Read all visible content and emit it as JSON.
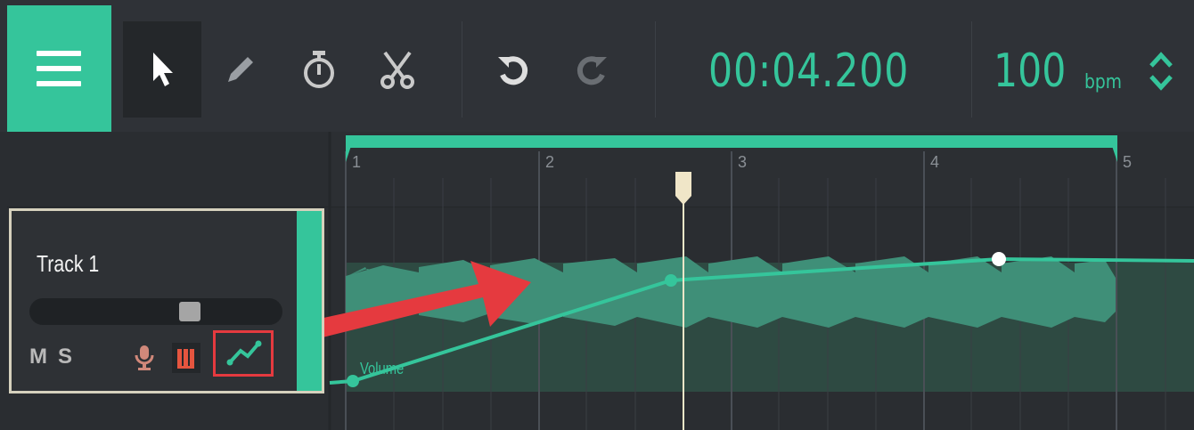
{
  "toolbar": {
    "menu_icon": "hamburger-menu-icon",
    "tools": [
      {
        "name": "select-tool",
        "icon": "cursor-arrow-icon",
        "active": true
      },
      {
        "name": "pencil-tool",
        "icon": "pencil-icon",
        "active": false
      },
      {
        "name": "metronome-tool",
        "icon": "stopwatch-icon",
        "active": false
      },
      {
        "name": "cut-tool",
        "icon": "scissors-icon",
        "active": false
      }
    ],
    "undo_icon": "undo-icon",
    "redo_icon": "redo-icon",
    "time": "00:04.200",
    "bpm_value": "100",
    "bpm_unit": "bpm",
    "accent_color": "#35c59b"
  },
  "ruler": {
    "bar_numbers": [
      "1",
      "2",
      "3",
      "4",
      "5"
    ],
    "loop_color": "#35c59b",
    "playhead_color": "#f0e6c8"
  },
  "track": {
    "name": "Track 1",
    "volume_level": 0.65,
    "mute_label": "M",
    "solo_label": "S",
    "record_icon": "microphone-icon",
    "instrument_icon": "piano-keys-icon",
    "automation_icon": "automation-line-icon"
  },
  "automation": {
    "label": "Volume"
  },
  "annotation": {
    "arrow_color": "#e53a3f"
  }
}
